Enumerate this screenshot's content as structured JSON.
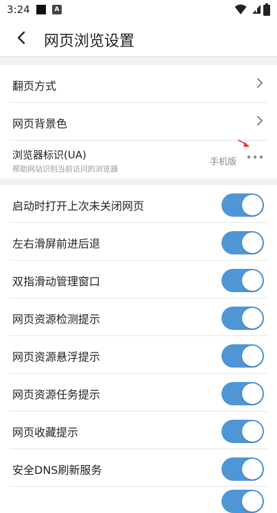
{
  "status_bar": {
    "time": "3:24",
    "notif_icon_a": "A"
  },
  "app_bar": {
    "title": "网页浏览设置"
  },
  "nav_rows": [
    {
      "label": "翻页方式"
    },
    {
      "label": "网页背景色"
    }
  ],
  "ua_row": {
    "title": "浏览器标识(UA)",
    "subtitle": "帮助网站识别当前访问的浏览器",
    "value": "手机版"
  },
  "toggles": [
    {
      "label": "启动时打开上次未关闭网页",
      "on": true
    },
    {
      "label": "左右滑屏前进后退",
      "on": true
    },
    {
      "label": "双指滑动管理窗口",
      "on": true
    },
    {
      "label": "网页资源检测提示",
      "on": true
    },
    {
      "label": "网页资源悬浮提示",
      "on": true
    },
    {
      "label": "网页资源任务提示",
      "on": true
    },
    {
      "label": "网页收藏提示",
      "on": true
    },
    {
      "label": "安全DNS刷新服务",
      "on": true
    }
  ],
  "colors": {
    "accent": "#4f96d6",
    "divider": "#e6e6e6",
    "annotation": "#e53935"
  }
}
